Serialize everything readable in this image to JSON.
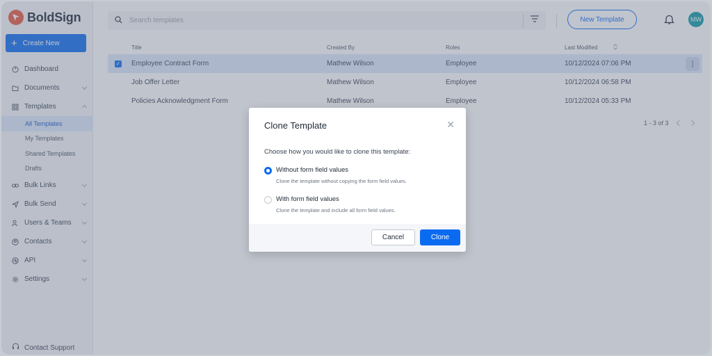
{
  "app": {
    "name": "BoldSign",
    "brand_color": "#e8563f",
    "accent_color": "#0b6bf0"
  },
  "sidebar": {
    "create_new": "Create New",
    "items": [
      {
        "label": "Dashboard",
        "icon": "dashboard-icon"
      },
      {
        "label": "Documents",
        "icon": "folder-icon"
      },
      {
        "label": "Templates",
        "icon": "grid-icon"
      },
      {
        "label": "Bulk Links",
        "icon": "link-icon"
      },
      {
        "label": "Bulk Send",
        "icon": "send-icon"
      },
      {
        "label": "Users & Teams",
        "icon": "users-icon"
      },
      {
        "label": "Contacts",
        "icon": "contact-icon"
      },
      {
        "label": "API",
        "icon": "api-icon"
      },
      {
        "label": "Settings",
        "icon": "gear-icon"
      }
    ],
    "templates_sub": [
      "All Templates",
      "My Templates",
      "Shared Templates",
      "Drafts"
    ],
    "support": "Contact Support"
  },
  "topbar": {
    "search_placeholder": "Search templates",
    "new_template": "New Template",
    "avatar_initials": "MW"
  },
  "table": {
    "headers": {
      "title": "Title",
      "created_by": "Created By",
      "roles": "Roles",
      "last_modified": "Last Modified"
    },
    "rows": [
      {
        "title": "Employee Contract Form",
        "created_by": "Mathew Wilson",
        "roles": "Employee",
        "modified": "10/12/2024 07:06 PM"
      },
      {
        "title": "Job Offer Letter",
        "created_by": "Mathew Wilson",
        "roles": "Employee",
        "modified": "10/12/2024 06:58 PM"
      },
      {
        "title": "Policies Acknowledgment Form",
        "created_by": "Mathew Wilson",
        "roles": "Employee",
        "modified": "10/12/2024 05:33 PM"
      }
    ],
    "pager": "1 - 3 of 3"
  },
  "modal": {
    "title": "Clone Template",
    "prompt": "Choose how you would like to clone this template:",
    "options": [
      {
        "label": "Without form field values",
        "desc": "Clone the template without copying the form field values.",
        "selected": true
      },
      {
        "label": "With form field values",
        "desc": "Clone the template and include all form field values.",
        "selected": false
      }
    ],
    "cancel": "Cancel",
    "clone": "Clone"
  }
}
